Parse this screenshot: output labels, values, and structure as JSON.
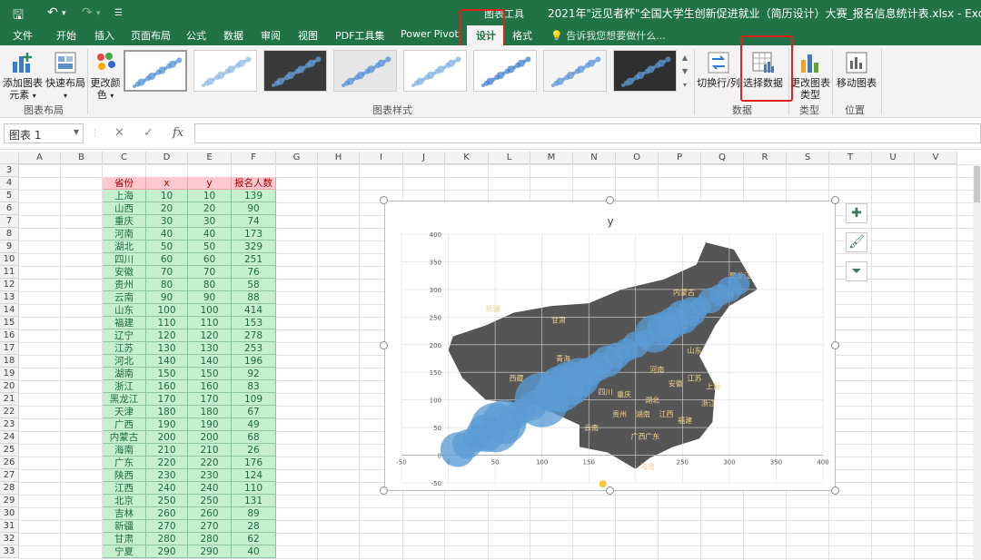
{
  "titlebar": {
    "context_tools": "图表工具",
    "window_title": "2021年\"远见者杯\"全国大学生创新促进就业（简历设计）大赛_报名信息统计表.xlsx - Excel"
  },
  "tabs": [
    "文件",
    "开始",
    "插入",
    "页面布局",
    "公式",
    "数据",
    "审阅",
    "视图",
    "PDF工具集",
    "Power Pivot",
    "设计",
    "格式"
  ],
  "active_tab": "设计",
  "tell_me": "告诉我您想要做什么...",
  "ribbon": {
    "add_element": "添加图表元素",
    "quick_layout": "快速布局",
    "change_colors": "更改颜色",
    "group_layout": "图表布局",
    "group_styles": "图表样式",
    "switch_rowcol": "切换行/列",
    "select_data": "选择数据",
    "group_data": "数据",
    "change_type": "更改图表类型",
    "group_type": "类型",
    "move_chart": "移动图表",
    "group_location": "位置"
  },
  "namebox": "图表 1",
  "fx": "fx",
  "columns": [
    "A",
    "B",
    "C",
    "D",
    "E",
    "F",
    "G",
    "H",
    "I",
    "J",
    "K",
    "L",
    "M",
    "N",
    "O",
    "P",
    "Q",
    "R",
    "S",
    "T",
    "U",
    "V"
  ],
  "rows": [
    3,
    4,
    5,
    6,
    7,
    8,
    9,
    10,
    11,
    12,
    13,
    14,
    15,
    16,
    17,
    18,
    19,
    20,
    21,
    22,
    23,
    24,
    25,
    26,
    27,
    28,
    29,
    30,
    31,
    32,
    33
  ],
  "table": {
    "headers": [
      "省份",
      "x",
      "y",
      "报名人数"
    ],
    "rows": [
      [
        "上海",
        10,
        10,
        139
      ],
      [
        "山西",
        20,
        20,
        90
      ],
      [
        "重庆",
        30,
        30,
        74
      ],
      [
        "河南",
        40,
        40,
        173
      ],
      [
        "湖北",
        50,
        50,
        329
      ],
      [
        "四川",
        60,
        60,
        251
      ],
      [
        "安徽",
        70,
        70,
        76
      ],
      [
        "贵州",
        80,
        80,
        58
      ],
      [
        "云南",
        90,
        90,
        88
      ],
      [
        "山东",
        100,
        100,
        414
      ],
      [
        "福建",
        110,
        110,
        153
      ],
      [
        "辽宁",
        120,
        120,
        278
      ],
      [
        "江苏",
        130,
        130,
        253
      ],
      [
        "河北",
        140,
        140,
        196
      ],
      [
        "湖南",
        150,
        150,
        92
      ],
      [
        "浙江",
        160,
        160,
        83
      ],
      [
        "黑龙江",
        170,
        170,
        109
      ],
      [
        "天津",
        180,
        180,
        67
      ],
      [
        "广西",
        190,
        190,
        49
      ],
      [
        "内蒙古",
        200,
        200,
        68
      ],
      [
        "海南",
        210,
        210,
        26
      ],
      [
        "广东",
        220,
        220,
        176
      ],
      [
        "陕西",
        230,
        230,
        124
      ],
      [
        "江西",
        240,
        240,
        110
      ],
      [
        "北京",
        250,
        250,
        131
      ],
      [
        "吉林",
        260,
        260,
        89
      ],
      [
        "新疆",
        270,
        270,
        28
      ],
      [
        "甘肃",
        280,
        280,
        62
      ],
      [
        "宁夏",
        290,
        290,
        40
      ]
    ]
  },
  "chart_data": {
    "type": "scatter",
    "title": "y",
    "x_ticks": [
      -50,
      0,
      50,
      100,
      150,
      200,
      250,
      300,
      350,
      400
    ],
    "y_ticks": [
      -50,
      0,
      50,
      100,
      150,
      200,
      250,
      300,
      350,
      400
    ],
    "xlim": [
      -50,
      400
    ],
    "ylim": [
      -50,
      400
    ],
    "points_x": [
      10,
      20,
      30,
      40,
      50,
      60,
      70,
      80,
      90,
      100,
      110,
      120,
      130,
      140,
      150,
      160,
      170,
      180,
      190,
      200,
      210,
      220,
      230,
      240,
      250,
      260,
      270,
      280,
      290,
      300,
      310
    ],
    "points_y": [
      10,
      20,
      30,
      40,
      50,
      60,
      70,
      80,
      90,
      100,
      110,
      120,
      130,
      140,
      150,
      160,
      170,
      180,
      190,
      200,
      210,
      220,
      230,
      240,
      250,
      260,
      270,
      280,
      290,
      300,
      310
    ],
    "sizes": [
      139,
      90,
      74,
      173,
      329,
      251,
      76,
      58,
      88,
      414,
      153,
      278,
      253,
      196,
      92,
      83,
      109,
      67,
      49,
      68,
      26,
      176,
      124,
      110,
      131,
      89,
      28,
      62,
      40,
      60,
      40
    ],
    "map_labels": [
      "黑龙江",
      "内蒙古",
      "吉林",
      "新疆",
      "甘肃",
      "宁夏",
      "青海",
      "山东",
      "河南",
      "江苏",
      "安徽",
      "上海",
      "西藏",
      "四川",
      "重庆",
      "湖北",
      "浙江",
      "贵州",
      "湖南",
      "江西",
      "福建",
      "云南",
      "广西",
      "广东",
      "海南"
    ],
    "bubble_color": "#5b9bd5",
    "map_color": "#555555"
  }
}
